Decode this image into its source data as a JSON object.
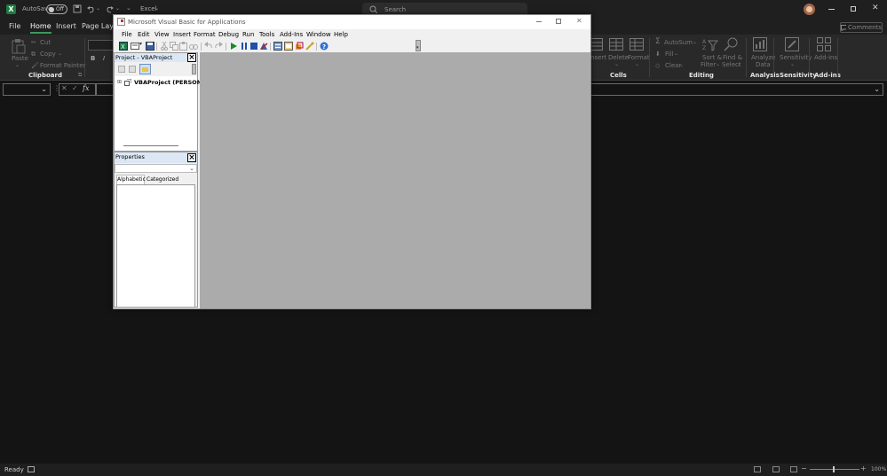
{
  "excel": {
    "title_bar": {
      "autosave_label": "AutoSave",
      "autosave_state": "Off",
      "doc_name": "Excel",
      "search_placeholder": "Search"
    },
    "tabs": [
      "File",
      "Home",
      "Insert",
      "Page Layou"
    ],
    "active_tab": "Home",
    "comments_label": "Comments",
    "ribbon": {
      "paste": "Paste",
      "cut": "Cut",
      "copy": "Copy",
      "format_painter": "Format Painter",
      "clipboard": "Clipboard",
      "bold": "B",
      "italic": "I",
      "insert": "nsert",
      "delete": "Delete",
      "format": "Format",
      "cells": "Cells",
      "autosum": "AutoSum",
      "fill": "Fill",
      "clear": "Clear",
      "sort_filter_1": "Sort &",
      "sort_filter_2": "Filter",
      "find_select_1": "Find &",
      "find_select_2": "Select",
      "editing": "Editing",
      "analyze_1": "Analyze",
      "analyze_2": "Data",
      "analysis": "Analysis",
      "sensitivity_btn": "Sensitivity",
      "sensitivity": "Sensitivity",
      "addins_btn": "Add-ins",
      "addins": "Add-ins"
    },
    "formula_bar": {
      "fx": "fx"
    },
    "status": {
      "ready": "Ready",
      "zoom": "100%"
    }
  },
  "vbe": {
    "title": "Microsoft Visual Basic for Applications",
    "menu": [
      "File",
      "Edit",
      "View",
      "Insert",
      "Format",
      "Debug",
      "Run",
      "Tools",
      "Add-Ins",
      "Window",
      "Help"
    ],
    "project_pane_title": "Project - VBAProject",
    "project_node": "VBAProject (PERSONAL.",
    "properties_pane_title": "Properties",
    "tab_alphabetic": "Alphabetic",
    "tab_categorized": "Categorized"
  },
  "colors": {
    "accent": "#3a9a5b",
    "excel_bg": "#141414",
    "ribbon_bg": "#292929",
    "mdi_bg": "#ababab"
  }
}
